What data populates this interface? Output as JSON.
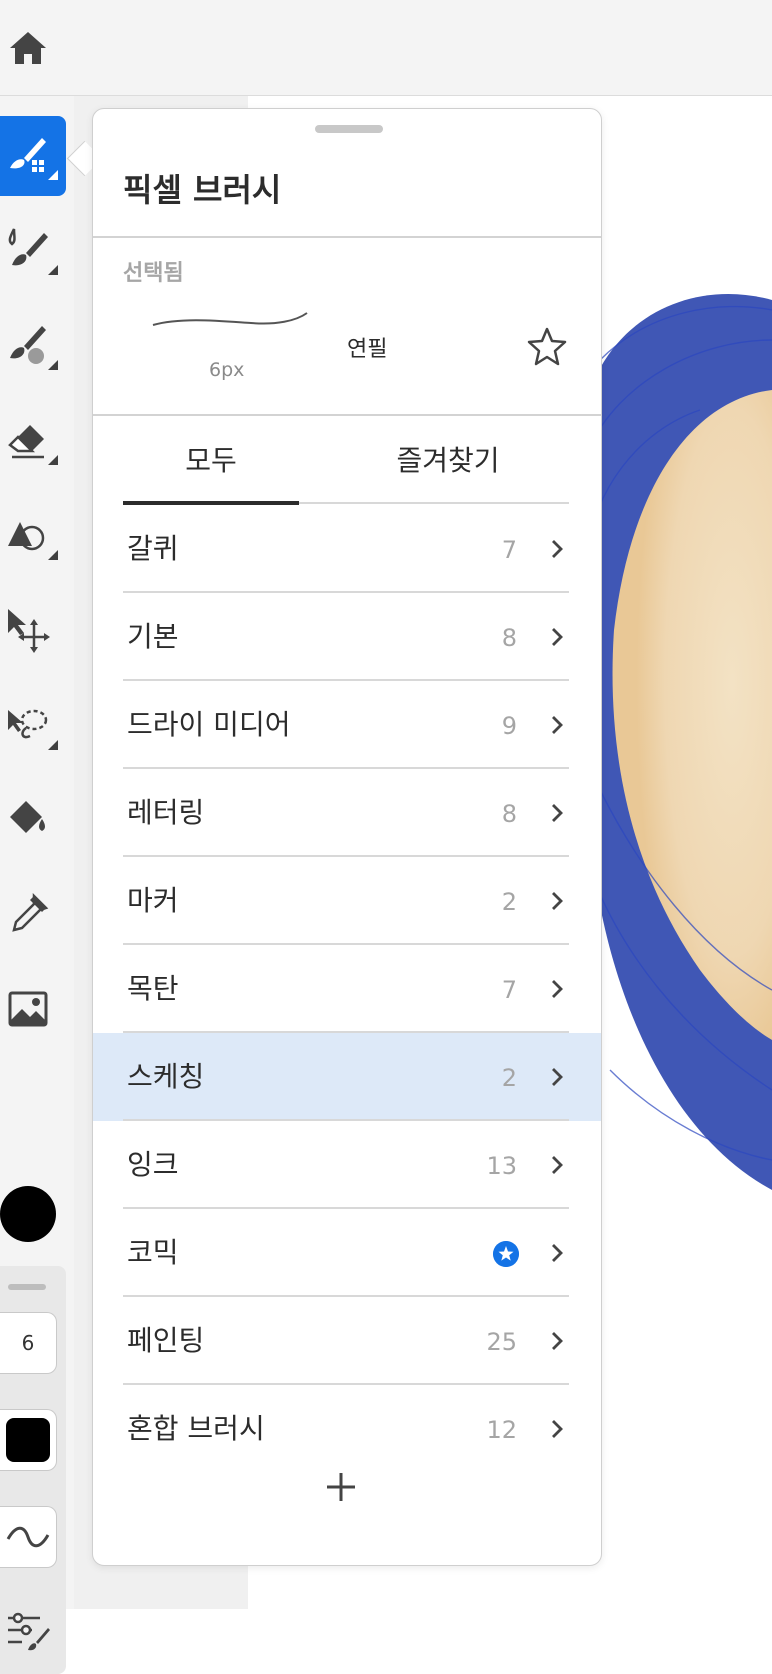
{
  "toolbar": {
    "tools": [
      {
        "name": "pixel-brush-tool",
        "icon": "pixel-brush-icon",
        "active": true
      },
      {
        "name": "live-brush-tool",
        "icon": "live-brush-icon"
      },
      {
        "name": "mixer-brush-tool",
        "icon": "mixer-brush-icon"
      },
      {
        "name": "eraser-tool",
        "icon": "eraser-icon"
      },
      {
        "name": "shape-tool",
        "icon": "shapes-icon"
      },
      {
        "name": "transform-tool",
        "icon": "move-icon"
      },
      {
        "name": "lasso-tool",
        "icon": "lasso-icon"
      },
      {
        "name": "fill-tool",
        "icon": "paint-bucket-icon"
      },
      {
        "name": "eyedropper-tool",
        "icon": "eyedropper-icon"
      },
      {
        "name": "image-tool",
        "icon": "image-icon"
      }
    ],
    "current_color": "#000000",
    "brush_size_value": "6"
  },
  "panel": {
    "title": "픽셀 브러시",
    "selected_label": "선택됨",
    "selected_brush": {
      "name": "연필",
      "size": "6px"
    },
    "tabs": [
      {
        "label": "모두",
        "active": true
      },
      {
        "label": "즐겨찾기",
        "active": false
      }
    ],
    "categories": [
      {
        "label": "갈퀴",
        "count": "7"
      },
      {
        "label": "기본",
        "count": "8"
      },
      {
        "label": "드라이 미디어",
        "count": "9"
      },
      {
        "label": "레터링",
        "count": "8"
      },
      {
        "label": "마커",
        "count": "2"
      },
      {
        "label": "목탄",
        "count": "7"
      },
      {
        "label": "스케칭",
        "count": "2",
        "selected": true
      },
      {
        "label": "잉크",
        "count": "13"
      },
      {
        "label": "코믹",
        "count": "",
        "badge": "star-badge-icon"
      },
      {
        "label": "페인팅",
        "count": "25"
      },
      {
        "label": "혼합 브러시",
        "count": "12"
      }
    ]
  },
  "colors": {
    "accent": "#1473e6",
    "selected_row": "#dde9f8",
    "canvas_blue": "#1f3aa8",
    "canvas_skin": "#f1dcb8"
  }
}
